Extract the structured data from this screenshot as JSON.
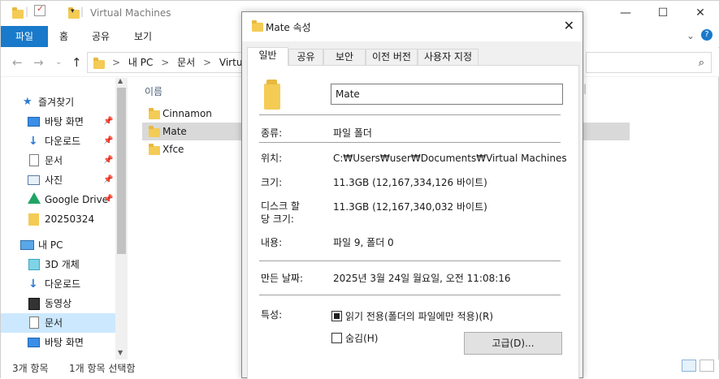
{
  "explorer": {
    "title": "Virtual Machines",
    "window_controls": {
      "minimize": "—",
      "maximize": "☐",
      "close": "✕"
    },
    "ribbon_tabs": [
      "파일",
      "홈",
      "공유",
      "보기"
    ],
    "address": {
      "segments": [
        "내 PC",
        ">",
        "문서",
        ">",
        "Virtual M"
      ]
    },
    "nav_pane": {
      "items": [
        {
          "label": "즐겨찾기",
          "icon": "star-icon",
          "pinned": false
        },
        {
          "label": "바탕 화면",
          "icon": "desktop-icon",
          "pinned": true
        },
        {
          "label": "다운로드",
          "icon": "download-icon",
          "pinned": true
        },
        {
          "label": "문서",
          "icon": "document-icon",
          "pinned": true
        },
        {
          "label": "사진",
          "icon": "picture-icon",
          "pinned": true
        },
        {
          "label": "Google Drive",
          "icon": "google-drive-icon",
          "pinned": true
        },
        {
          "label": "20250324",
          "icon": "folder-icon",
          "pinned": false
        },
        {
          "label": "내 PC",
          "icon": "pc-icon",
          "pinned": false
        },
        {
          "label": "3D 개체",
          "icon": "3d-objects-icon",
          "pinned": false
        },
        {
          "label": "다운로드",
          "icon": "download-icon",
          "pinned": false
        },
        {
          "label": "동영상",
          "icon": "video-icon",
          "pinned": false
        },
        {
          "label": "문서",
          "icon": "document-icon",
          "pinned": false
        },
        {
          "label": "바탕 화면",
          "icon": "desktop-icon",
          "pinned": false
        }
      ]
    },
    "file_list": {
      "column_name": "이름",
      "files": [
        "Cinnamon",
        "Mate",
        "Xfce"
      ],
      "selected": "Mate"
    },
    "status": {
      "item_count": "3개 항목",
      "selected_count": "1개 항목 선택함"
    }
  },
  "dialog": {
    "title": "Mate 속성",
    "close": "✕",
    "tabs": [
      "일반",
      "공유",
      "보안",
      "이전 버전",
      "사용자 지정"
    ],
    "name_value": "Mate",
    "fields": {
      "type_label": "종류:",
      "type_value": "파일 폴더",
      "location_label": "위치:",
      "location_value": "C:₩Users₩user₩Documents₩Virtual Machines",
      "size_label": "크기:",
      "size_value": "11.3GB (12,167,334,126 바이트)",
      "disk_size_label_1": "디스크 할",
      "disk_size_label_2": "당 크기:",
      "disk_size_value": "11.3GB (12,167,340,032 바이트)",
      "contains_label": "내용:",
      "contains_value": "파일 9, 폴더 0",
      "created_label": "만든 날짜:",
      "created_value": "2025년 3월 24일 월요일, 오전 11:08:16",
      "attributes_label": "특성:",
      "readonly_label": "읽기 전용(폴더의 파일에만 적용)(R)",
      "hidden_label": "숨김(H)",
      "advanced_button": "고급(D)..."
    },
    "readonly_state": "indeterminate",
    "hidden_checked": false
  }
}
